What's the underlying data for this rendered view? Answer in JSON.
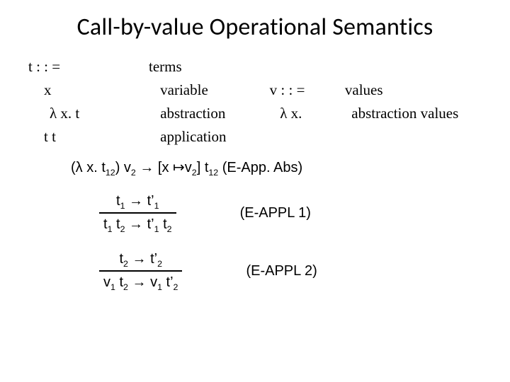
{
  "title": "Call-by-value Operational Semantics",
  "grammar": {
    "t_head": "t : : =",
    "t_head_desc": "terms",
    "t_var": "x",
    "t_var_desc": "variable",
    "t_abs": "λ x. t",
    "t_abs_desc": "abstraction",
    "t_app": "t t",
    "t_app_desc": "application",
    "v_head": "v : : =",
    "v_head_desc": "values",
    "v_abs": "λ x.",
    "v_abs_desc": "abstraction values"
  },
  "beta": {
    "lhs_open": "(λ x. t",
    "t12a_sub": "12",
    "close_v": ") v",
    "v2_sub": "2",
    "arrow_sub": " → [x ↦v",
    "close_t": "] t",
    "t12b_sub": "12",
    "tag": " (E-App. Abs)"
  },
  "rule1": {
    "prem_l": "t",
    "prem_l_sub": "1",
    "arrow": " → ",
    "prem_r": "t’",
    "prem_r_sub": "1",
    "conc_l1": "t",
    "conc_l1_sub": "1",
    "conc_l2": " t",
    "conc_l2_sub": "2",
    "conc_r1": " t’",
    "conc_r1_sub": "1",
    "conc_r2": " t",
    "conc_r2_sub": "2",
    "tag": "(E-APPL 1)"
  },
  "rule2": {
    "prem_l": "t",
    "prem_l_sub": "2",
    "arrow": " → ",
    "prem_r": "t’",
    "prem_r_sub": "2",
    "conc_l1": "v",
    "conc_l1_sub": "1",
    "conc_l2": " t",
    "conc_l2_sub": "2",
    "conc_r1": " v",
    "conc_r1_sub": "1",
    "conc_r2": " t’",
    "conc_r2_sub": "2",
    "tag": "(E-APPL 2)"
  }
}
